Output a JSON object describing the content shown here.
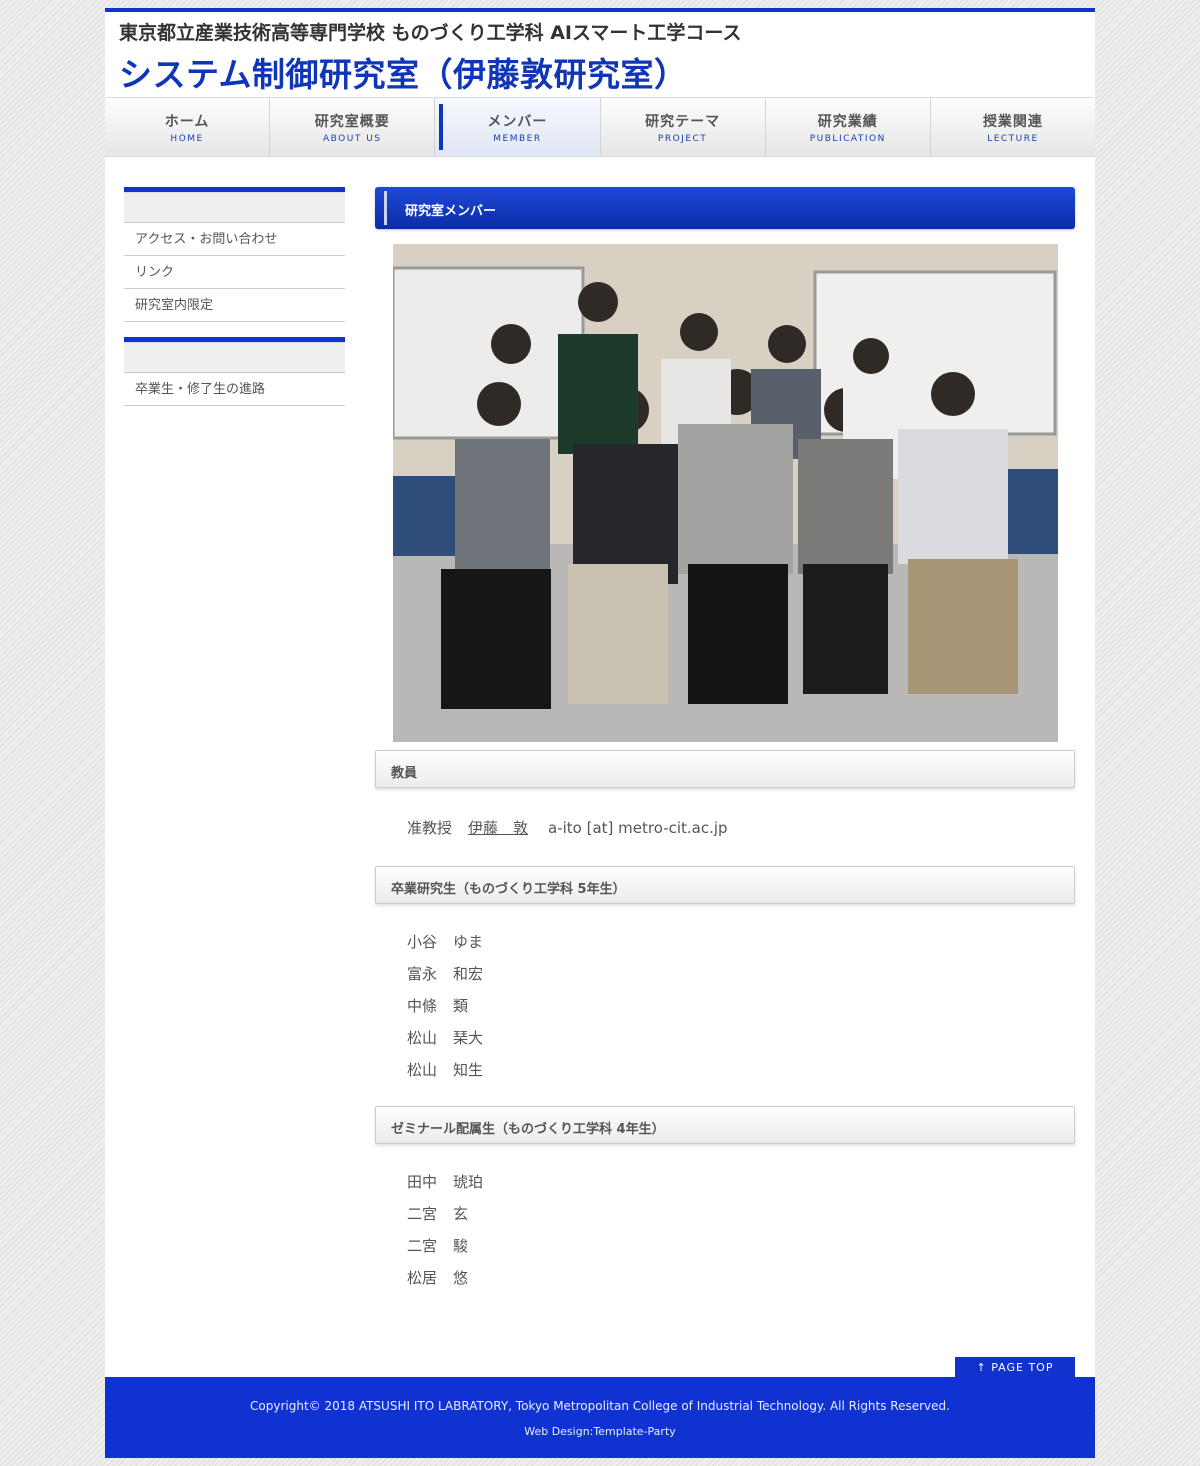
{
  "header": {
    "subtitle": "東京都立産業技術高等専門学校 ものづくり工学科 AIスマート工学コース",
    "title": "システム制御研究室（伊藤敦研究室）"
  },
  "nav": [
    {
      "jp": "ホーム",
      "en": "HOME"
    },
    {
      "jp": "研究室概要",
      "en": "ABOUT US"
    },
    {
      "jp": "メンバー",
      "en": "MEMBER"
    },
    {
      "jp": "研究テーマ",
      "en": "PROJECT"
    },
    {
      "jp": "研究業績",
      "en": "PUBLICATION"
    },
    {
      "jp": "授業関連",
      "en": "LECTURE"
    }
  ],
  "sidebar": {
    "box1": [
      "アクセス・お問い合わせ",
      "リンク",
      "研究室内限定"
    ],
    "box2": [
      "卒業生・修了生の進路"
    ]
  },
  "main": {
    "heading": "研究室メンバー",
    "faculty": {
      "heading": "教員",
      "title": "准教授",
      "name": "伊藤　敦",
      "email": "a-ito [at] metro-cit.ac.jp"
    },
    "graduates": {
      "heading": "卒業研究生（ものづくり工学科 5年生）",
      "members": [
        {
          "family": "小谷",
          "given": "ゆま"
        },
        {
          "family": "富永",
          "given": "和宏"
        },
        {
          "family": "中條",
          "given": "類"
        },
        {
          "family": "松山",
          "given": "琹大"
        },
        {
          "family": "松山",
          "given": "知生"
        }
      ]
    },
    "seminar": {
      "heading": "ゼミナール配属生（ものづくり工学科 4年生）",
      "members": [
        {
          "family": "田中",
          "given": "琥珀"
        },
        {
          "family": "二宮",
          "given": "玄"
        },
        {
          "family": "二宮",
          "given": "駿"
        },
        {
          "family": "松居",
          "given": "悠"
        }
      ]
    }
  },
  "pagetop": "↑ PAGE TOP",
  "footer": {
    "copyright": "Copyright© 2018 ATSUSHI ITO LABRATORY, Tokyo Metropolitan College of Industrial Technology. All Rights Reserved.",
    "design": "Web Design:Template-Party"
  },
  "colors": {
    "accent": "#1133cc",
    "title": "#0f35b8"
  }
}
